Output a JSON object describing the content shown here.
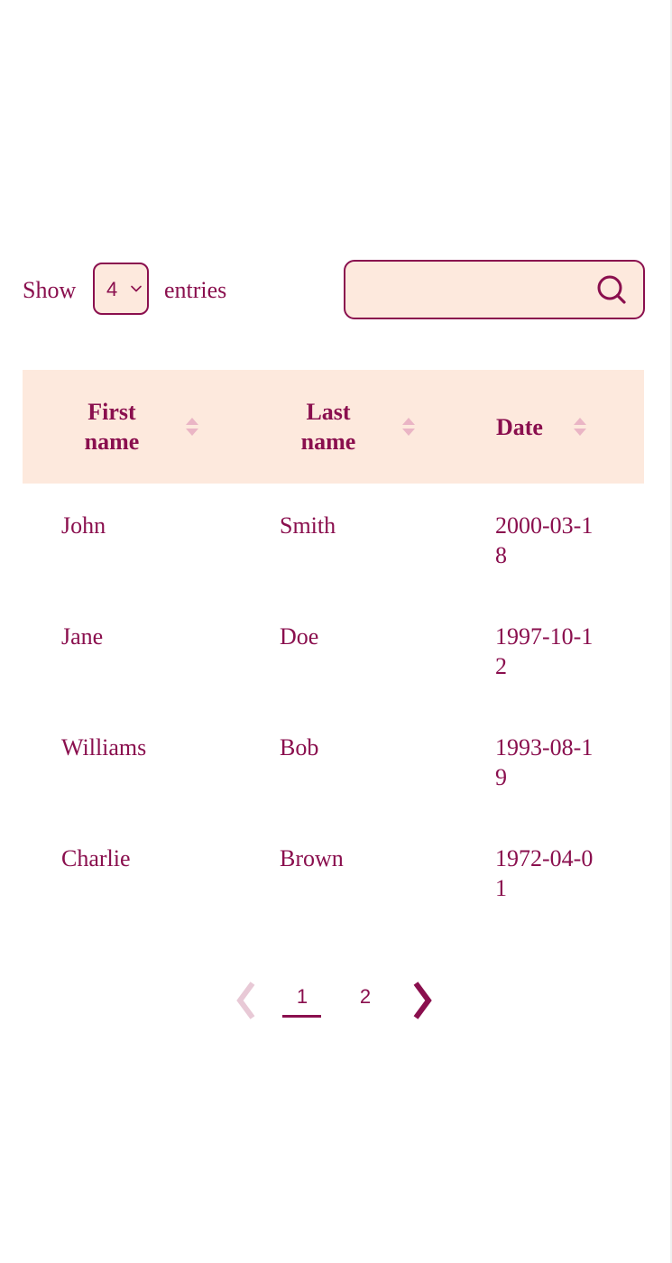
{
  "controls": {
    "show_label": "Show",
    "entries_value": "4",
    "entries_label": "entries",
    "search": {
      "value": "",
      "placeholder": ""
    }
  },
  "table": {
    "columns": [
      {
        "label": "First name",
        "sort_icon": "sort-both-icon"
      },
      {
        "label": "Last name",
        "sort_icon": "sort-both-icon"
      },
      {
        "label": "Date",
        "sort_icon": "sort-both-icon"
      }
    ],
    "rows": [
      {
        "first": "John",
        "last": "Smith",
        "date": "2000-03-18"
      },
      {
        "first": "Jane",
        "last": "Doe",
        "date": "1997-10-12"
      },
      {
        "first": "Williams",
        "last": "Bob",
        "date": "1993-08-19"
      },
      {
        "first": "Charlie",
        "last": "Brown",
        "date": "1972-04-01"
      }
    ]
  },
  "pagination": {
    "prev_icon": "chevron-left-icon",
    "pages": [
      "1",
      "2"
    ],
    "current_page": "1",
    "next_icon": "chevron-right-icon"
  },
  "colors": {
    "accent": "#8a0f4e",
    "header_background": "#fde9dd",
    "disabled": "#e8c9d6"
  }
}
